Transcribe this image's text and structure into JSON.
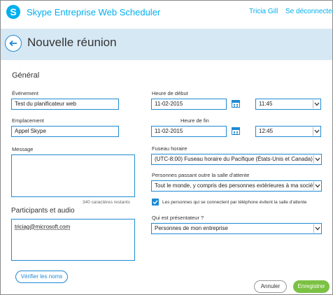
{
  "header": {
    "app_title": "Skype Entreprise Web Scheduler",
    "user_name": "Tricia Gill",
    "signout_label": "Se déconnecter"
  },
  "page": {
    "title": "Nouvelle réunion"
  },
  "general": {
    "section_title": "Général",
    "event_label": "Événement",
    "event_value": "Test du planificateur web",
    "location_label": "Emplacement",
    "location_value": "Appel Skype",
    "message_label": "Message",
    "message_value": "",
    "char_count": "340 caractères restants"
  },
  "participants": {
    "title": "Participants et audio",
    "entries": "triciag@microsoft.com",
    "verify_label": "Vérifier les noms"
  },
  "schedule": {
    "start_label": "Heure de début",
    "start_date": "11-02-2015",
    "start_time": "11:45",
    "end_label": "Heure de fin",
    "end_date": "11-02-2015",
    "end_time": "12:45",
    "timezone_label": "Fuseau horaire",
    "timezone_value": "(UTC-8:00) Fuseau horaire du Pacifique (États-Unis et Canada)",
    "lobby_label": "Personnes passant outre la salle d'attente",
    "lobby_value": "Tout le monde, y compris des personnes extérieures à ma société",
    "phone_bypass_label": "Les personnes qui se connectent par téléphone évitent la salle d'attente",
    "phone_bypass_checked": true,
    "presenter_label": "Qui est présentateur ?",
    "presenter_value": "Personnes de mon entreprise"
  },
  "actions": {
    "cancel_label": "Annuler",
    "register_label": "Enregistrer"
  },
  "colors": {
    "accent": "#00aff0",
    "primary": "#1f8ad3",
    "band": "#d6e8f4",
    "save": "#7bc143"
  },
  "icons": {
    "logo": "skype-logo",
    "back": "back-arrow-icon",
    "calendar": "calendar-icon",
    "dropdown": "chevron-down-icon",
    "check": "check-icon"
  }
}
